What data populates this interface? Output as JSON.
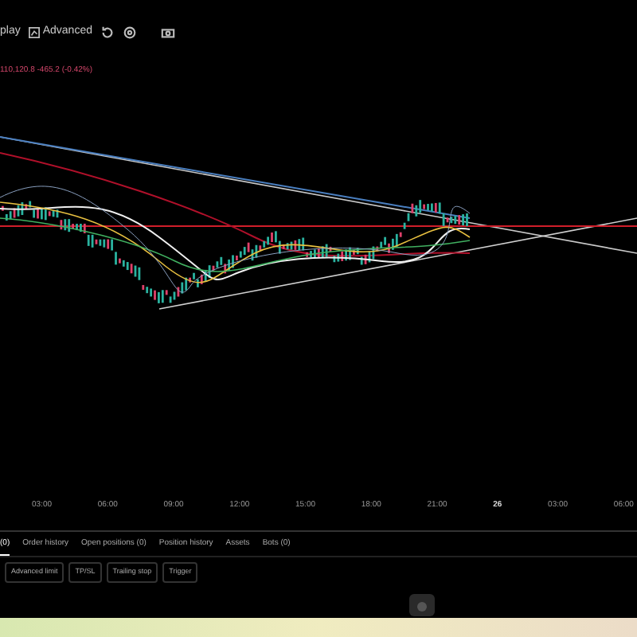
{
  "toolbar": {
    "items": [
      {
        "kind": "text",
        "label": "play"
      },
      {
        "kind": "icon-text",
        "label": "Advanced"
      },
      {
        "kind": "icon"
      },
      {
        "kind": "icon"
      },
      {
        "kind": "icon"
      }
    ]
  },
  "price_line": "110,120.8 -465.2 (-0.42%)",
  "time_axis": [
    {
      "label": "03:00",
      "bold": false
    },
    {
      "label": "06:00",
      "bold": false
    },
    {
      "label": "09:00",
      "bold": false
    },
    {
      "label": "12:00",
      "bold": false
    },
    {
      "label": "15:00",
      "bold": false
    },
    {
      "label": "18:00",
      "bold": false
    },
    {
      "label": "21:00",
      "bold": false
    },
    {
      "label": "26",
      "bold": true
    },
    {
      "label": "03:00",
      "bold": false
    },
    {
      "label": "06:00",
      "bold": false
    }
  ],
  "tabs": [
    {
      "label": "(0)",
      "selected": true
    },
    {
      "label": "Order history",
      "selected": false
    },
    {
      "label": "Open positions (0)",
      "selected": false
    },
    {
      "label": "Position history",
      "selected": false
    },
    {
      "label": "Assets",
      "selected": false
    },
    {
      "label": "Bots (0)",
      "selected": false
    }
  ],
  "order_types": [
    "Advanced limit",
    "TP/SL",
    "Trailing stop",
    "Trigger"
  ]
}
